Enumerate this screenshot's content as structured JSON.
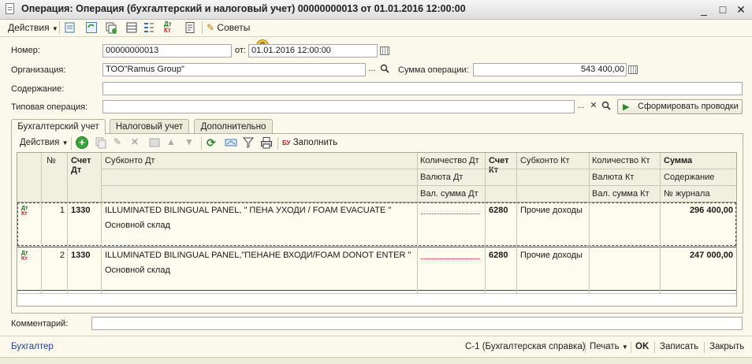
{
  "window": {
    "title": "Операция: Операция (бухгалтерский и налоговый учет) 00000000013 от 01.01.2016 12:00:00",
    "minimize": "_",
    "maximize": "□",
    "close": "✕"
  },
  "toolbar": {
    "actions_label": "Действия",
    "advice_label": "Советы",
    "help_label": "?"
  },
  "form": {
    "number_label": "Номер:",
    "number_value": "00000000013",
    "date_label": "от:",
    "date_value": "01.01.2016 12:00:00",
    "org_label": "Организация:",
    "org_value": "TOO\"Ramus Group\"",
    "sum_label": "Сумма операции:",
    "sum_value": "543 400,00",
    "content_label": "Содержание:",
    "content_value": "",
    "typical_label": "Типовая операция:",
    "typical_value": "",
    "generate_label": "Сформировать проводки",
    "ellipsis": "...",
    "clear_x": "✕",
    "comment_label": "Комментарий:",
    "comment_value": ""
  },
  "tabs": [
    {
      "label": "Бухгалтерский учет",
      "active": true
    },
    {
      "label": "Налоговый учет",
      "active": false
    },
    {
      "label": "Дополнительно",
      "active": false
    }
  ],
  "table_toolbar": {
    "actions_label": "Действия",
    "fill_label": "Заполнить"
  },
  "table": {
    "headers": {
      "num": "№",
      "dt_account": "Счет Дт",
      "subconto_dt": "Субконто Дт",
      "qty_dt": "Количество Дт",
      "currency_dt": "Валюта Дт",
      "cur_sum_dt": "Вал. сумма Дт",
      "kt_account": "Счет Кт",
      "subconto_kt": "Субконто Кт",
      "qty_kt": "Количество Кт",
      "currency_kt": "Валюта Кт",
      "cur_sum_kt": "Вал. сумма Кт",
      "sum": "Сумма",
      "content": "Содержание",
      "journal": "№ журнала"
    },
    "rows": [
      {
        "num": "1",
        "dt": "1330",
        "sub_dt1": "ILLUMINATED BILINGUAL PANEL, \" ПЕНА УХОДИ / FOAM EVACUATE \"",
        "sub_dt2": "Основной склад",
        "kt": "6280",
        "sub_kt": "Прочие доходы",
        "sum": "296 400,00"
      },
      {
        "num": "2",
        "dt": "1330",
        "sub_dt1": "ILLUMINATED BILINGUAL PANEL,\"ПЕНАНЕ ВХОДИ/FOAM DONOT ENTER \"",
        "sub_dt2": "Основной склад",
        "kt": "6280",
        "sub_kt": "Прочие доходы",
        "sum": "247 000,00"
      }
    ]
  },
  "status": {
    "user": "Бухгалтер",
    "report": "С-1 (Бухгалтерская справка)",
    "print": "Печать",
    "ok": "OK",
    "save": "Записать",
    "close": "Закрыть"
  }
}
